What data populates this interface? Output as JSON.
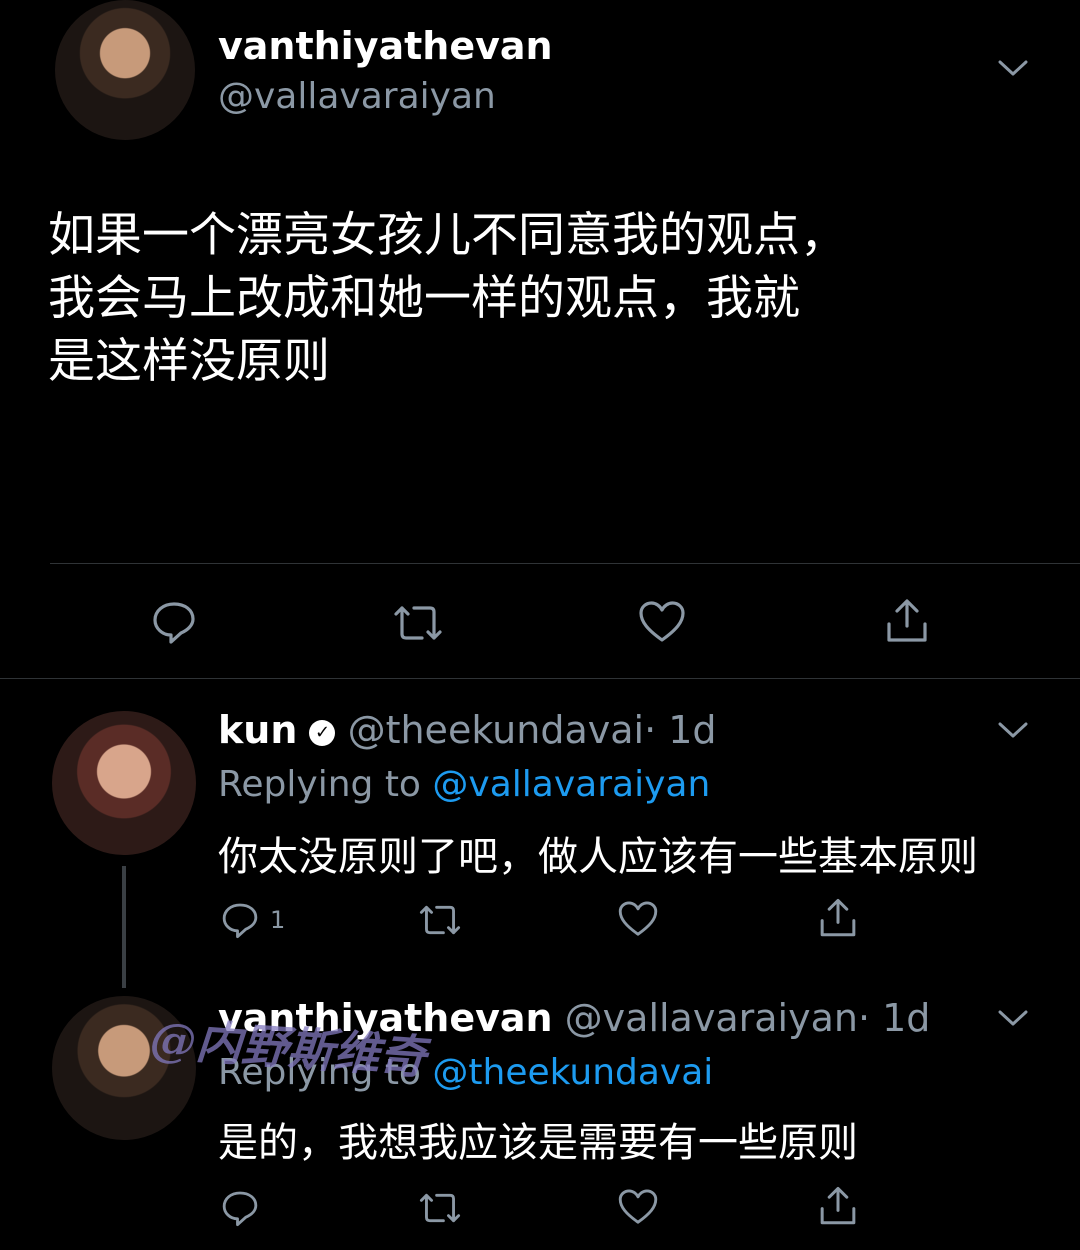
{
  "main_tweet": {
    "display_name": "vanthiyathevan",
    "handle": "@vallavaraiyan",
    "text_lines": [
      "如果一个漂亮女孩儿不同意我的观点，",
      "我会马上改成和她一样的观点，我就",
      "是这样没原则"
    ]
  },
  "reply_1": {
    "display_name": "kun",
    "handle": "@theekundavai",
    "time": "· 1d",
    "replying_label": "Replying to",
    "replying_to": "@vallavaraiyan",
    "text": "你太没原则了吧，做人应该有一些基本原则",
    "reply_count": "1"
  },
  "reply_2": {
    "display_name": "vanthiyathevan",
    "handle": "@vallavaraiyan",
    "time": "· 1d",
    "replying_label": "Replying to",
    "replying_to": "@theekundavai",
    "text": "是的，我想我应该是需要有一些原则"
  },
  "watermark": "@内野斯维奇",
  "icons": {
    "reply": "reply-icon",
    "retweet": "retweet-icon",
    "like": "like-icon",
    "share": "share-icon",
    "more": "chevron-down-icon",
    "verified": "verified-badge-icon"
  },
  "colors": {
    "background": "#000000",
    "text": "#ffffff",
    "muted": "#8b98a5",
    "link": "#1d9bf0"
  }
}
